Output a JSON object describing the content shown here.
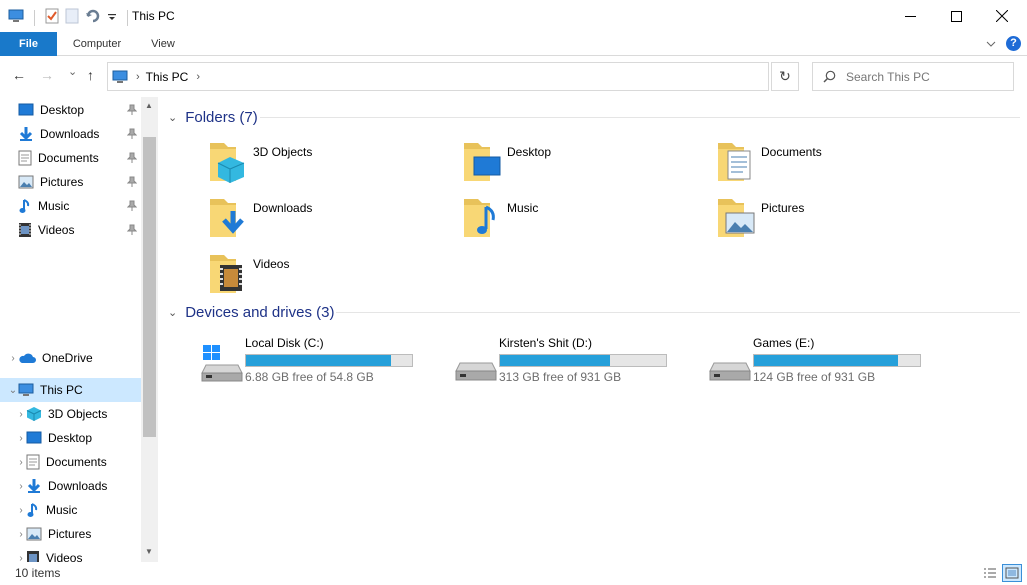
{
  "window": {
    "title": "This PC",
    "controls": {
      "minimize": "—",
      "maximize": "☐",
      "close": "✕"
    }
  },
  "ribbon": {
    "tabs": [
      {
        "label": "File"
      },
      {
        "label": "Computer"
      },
      {
        "label": "View"
      }
    ],
    "help": "?"
  },
  "navigation": {
    "back": "←",
    "forward": "→",
    "recent": "⌄",
    "up": "↑",
    "address_segments": [
      "This PC"
    ],
    "refresh": "↻",
    "search_placeholder": "Search This PC"
  },
  "nav_pane": {
    "quick_access": [
      {
        "label": "Desktop",
        "icon": "desktop-icon",
        "pinned": true
      },
      {
        "label": "Downloads",
        "icon": "downloads-icon",
        "pinned": true
      },
      {
        "label": "Documents",
        "icon": "documents-icon",
        "pinned": true
      },
      {
        "label": "Pictures",
        "icon": "pictures-icon",
        "pinned": true
      },
      {
        "label": "Music",
        "icon": "music-icon",
        "pinned": true
      },
      {
        "label": "Videos",
        "icon": "videos-icon",
        "pinned": true
      }
    ],
    "onedrive": {
      "label": "OneDrive"
    },
    "this_pc": {
      "label": "This PC",
      "selected": true
    },
    "this_pc_children": [
      {
        "label": "3D Objects",
        "icon": "3d-objects-icon"
      },
      {
        "label": "Desktop",
        "icon": "desktop-icon"
      },
      {
        "label": "Documents",
        "icon": "documents-icon"
      },
      {
        "label": "Downloads",
        "icon": "downloads-icon"
      },
      {
        "label": "Music",
        "icon": "music-icon"
      },
      {
        "label": "Pictures",
        "icon": "pictures-icon"
      },
      {
        "label": "Videos",
        "icon": "videos-icon"
      }
    ]
  },
  "content": {
    "folders_header": "Folders (7)",
    "folders": [
      {
        "label": "3D Objects",
        "icon": "3d-objects-folder-icon"
      },
      {
        "label": "Desktop",
        "icon": "desktop-folder-icon"
      },
      {
        "label": "Documents",
        "icon": "documents-folder-icon"
      },
      {
        "label": "Downloads",
        "icon": "downloads-folder-icon"
      },
      {
        "label": "Music",
        "icon": "music-folder-icon"
      },
      {
        "label": "Pictures",
        "icon": "pictures-folder-icon"
      },
      {
        "label": "Videos",
        "icon": "videos-folder-icon"
      }
    ],
    "drives_header": "Devices and drives (3)",
    "drives": [
      {
        "label": "Local Disk (C:)",
        "free_text": "6.88 GB free of 54.8 GB",
        "used_fraction": 0.874,
        "system": true
      },
      {
        "label": "Kirsten's Shit (D:)",
        "free_text": "313 GB free of 931 GB",
        "used_fraction": 0.664,
        "system": false
      },
      {
        "label": "Games (E:)",
        "free_text": "124 GB free of 931 GB",
        "used_fraction": 0.867,
        "system": false
      }
    ]
  },
  "status_bar": {
    "item_count": "10 items"
  },
  "colors": {
    "accent": "#1979ca",
    "drive_bar": "#26a0da",
    "group_header": "#1e3287",
    "selection": "#cce8ff",
    "folder_yellow": "#f8d775"
  }
}
